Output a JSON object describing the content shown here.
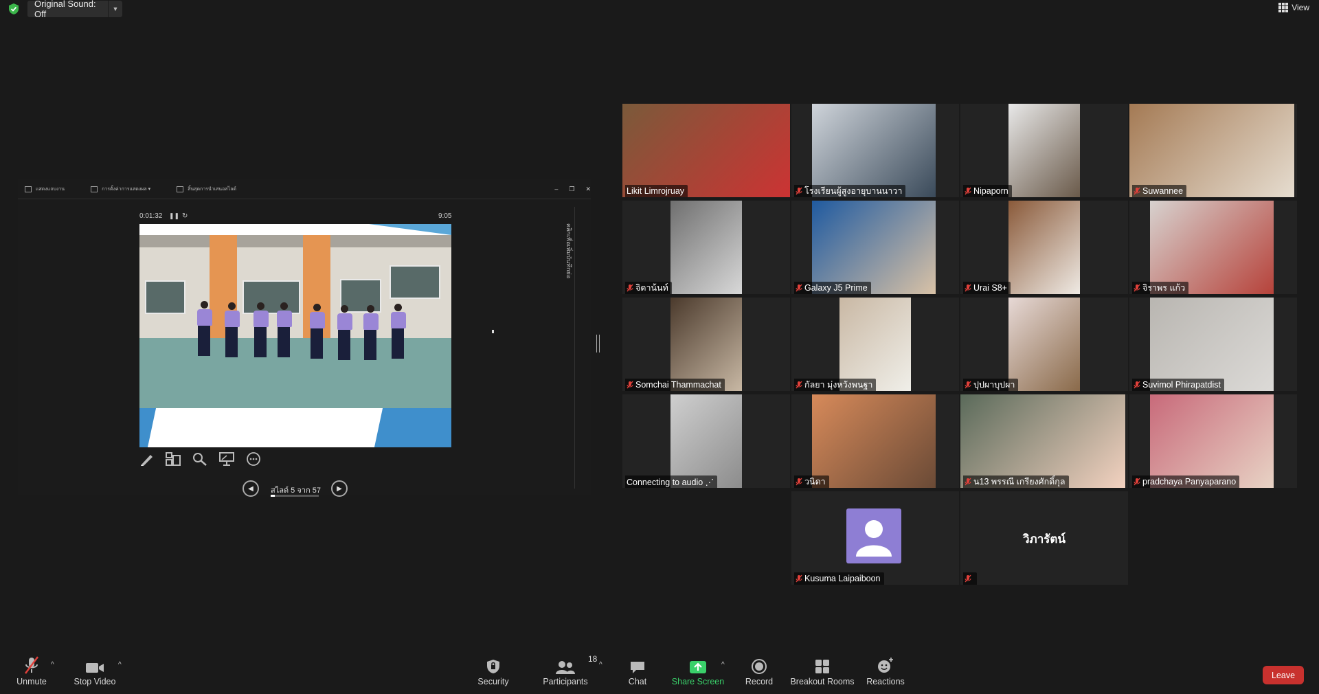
{
  "topbar": {
    "sound_label": "Original Sound: Off",
    "view_label": "View"
  },
  "share": {
    "toolbar_items": [
      "แสดงแถบงาน",
      "การตั้งค่าการแสดงผล ▾",
      "สิ้นสุดการนำเสนอสไลด์"
    ],
    "side_text": "คลิกเพื่อเพิ่มบันทึกย่อ",
    "video_elapsed": "0:01:32",
    "video_duration": "9:05",
    "slide_label": "สไลด์ 5 จาก 57",
    "slide_progress": 0.09
  },
  "tiles": [
    {
      "name": "Likit Limrojruay",
      "muted": false,
      "active": true
    },
    {
      "name": "โรงเรียนผู้สูงอายุบานนาวา",
      "muted": true
    },
    {
      "name": "Nipaporn",
      "muted": true
    },
    {
      "name": "Suwannee",
      "muted": true
    },
    {
      "name": "จิดาน้นท์",
      "muted": true
    },
    {
      "name": "Galaxy J5 Prime",
      "muted": true
    },
    {
      "name": "Urai S8+",
      "muted": true
    },
    {
      "name": "จิราพร แก้ว",
      "muted": true
    },
    {
      "name": "Somchai Thammachat",
      "muted": true
    },
    {
      "name": "กัลยา มุ่งหวังพนฐา",
      "muted": true
    },
    {
      "name": "ปุปผาบุปผา",
      "muted": true
    },
    {
      "name": "Suvimol Phirapatdist",
      "muted": true
    },
    {
      "name": "Connecting to audio ⋰",
      "muted": false
    },
    {
      "name": "วนิดา",
      "muted": true
    },
    {
      "name": "น13 พรรณี เกรียงศักดิ์กุล",
      "muted": true
    },
    {
      "name": "pradchaya Panyaparano",
      "muted": true
    },
    {
      "name": "Kusuma Laipaiboon",
      "muted": true
    },
    {
      "name": "",
      "muted": true,
      "display_name": "วิภารัตน์"
    }
  ],
  "toolbar": {
    "unmute": "Unmute",
    "stop_video": "Stop Video",
    "security": "Security",
    "participants": "Participants",
    "participants_count": "18",
    "chat": "Chat",
    "share_screen": "Share Screen",
    "record": "Record",
    "breakout": "Breakout Rooms",
    "reactions": "Reactions",
    "leave": "Leave"
  },
  "colors": {
    "background": "#1a1a1a",
    "active_speaker": "#dde24a",
    "share_green": "#3ad06a",
    "leave_red": "#c8312e",
    "muted_red": "#e0403a"
  }
}
